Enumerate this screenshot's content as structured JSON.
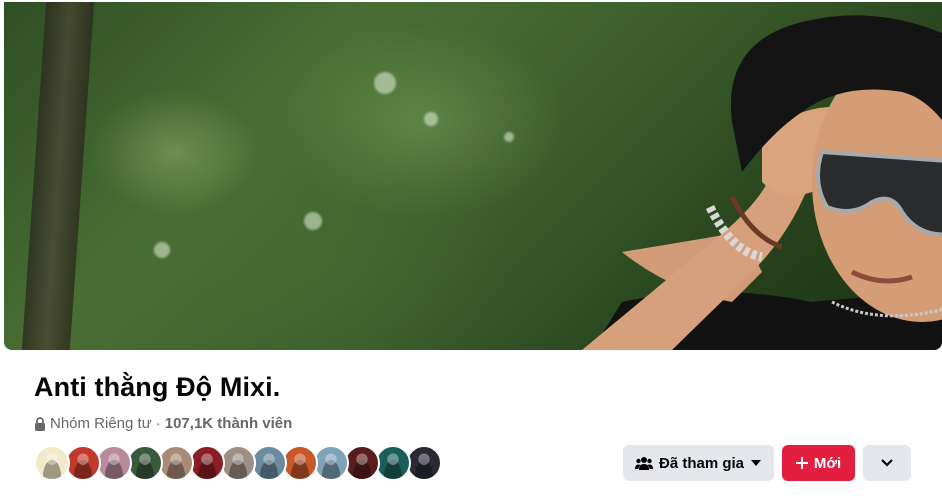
{
  "group": {
    "name": "Anti thằng Độ Mixi.",
    "privacy": "Nhóm Riêng tư",
    "separator": "·",
    "member_count": "107,1K thành viên"
  },
  "member_avatars": [
    {
      "color": "#f2e9c9"
    },
    {
      "color": "#c0392b"
    },
    {
      "color": "#b88a9c"
    },
    {
      "color": "#3a5a3c"
    },
    {
      "color": "#a98a76"
    },
    {
      "color": "#8b1e24"
    },
    {
      "color": "#9c8f86"
    },
    {
      "color": "#6b8a9e"
    },
    {
      "color": "#c8582a"
    },
    {
      "color": "#7ea3b9"
    },
    {
      "color": "#5a1d1d"
    },
    {
      "color": "#1c5f5a"
    },
    {
      "color": "#2a2a35"
    }
  ],
  "actions": {
    "joined_label": "Đã tham gia",
    "new_label": "Mới"
  },
  "colors": {
    "accent": "#e41e3f",
    "button_gray": "#e4e6eb",
    "secondary_text": "#65676b"
  }
}
